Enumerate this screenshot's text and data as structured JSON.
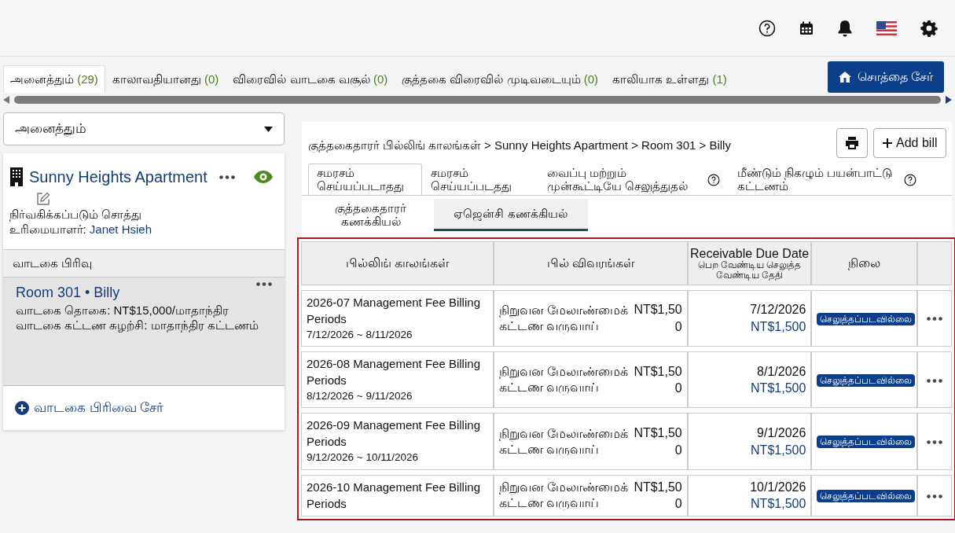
{
  "filter_tabs": [
    {
      "label": "அனைத்தும்",
      "count": "(29)",
      "selected": true
    },
    {
      "label": "காலாவதியானது",
      "count": "(0)",
      "selected": false
    },
    {
      "label": "விரைவில் வாடகை வசூல்",
      "count": "(0)",
      "selected": false
    },
    {
      "label": "குத்தகை விரைவில் முடிவடையும்",
      "count": "(0)",
      "selected": false
    },
    {
      "label": "காலியாக உள்ளது",
      "count": "(1)",
      "selected": false
    }
  ],
  "add_property_button": "சொத்தை சேர்",
  "property_select": {
    "value": "அனைத்தும்"
  },
  "property": {
    "name": "Sunny Heights Apartment",
    "visible": true,
    "type": "நிர்வகிக்கப்படும் சொத்து",
    "owner_label": "உரிமையாளர்:",
    "owner": "Janet Hsieh"
  },
  "section_header": "வாடகை பிரிவு",
  "units": [
    {
      "title": "Room 301 • Billy",
      "selected": true,
      "lines": [
        "வாடகை தொகை: NT$15,000/மாதாந்திர",
        "வாடகை கட்டண சுழற்சி: மாதாந்திர கட்டணம்"
      ]
    }
  ],
  "add_unit_link": "வாடகை பிரிவை சேர்",
  "breadcrumb": "குத்தகைதாரர் பில்லிங் காலங்கள் > Sunny Heights Apartment > Room 301 > Billy",
  "add_bill_button": "Add bill",
  "main_tabs": [
    {
      "label": "சமரசம் செய்யப்படாதது",
      "help": false,
      "selected": true
    },
    {
      "label": "சமரசம் செய்யப்படதது",
      "help": false,
      "selected": false
    },
    {
      "label": "வைப்பு மற்றும் முன்கூட்டியே செலுத்துதல்",
      "help": true,
      "selected": false
    },
    {
      "label": "மீண்டும் நிகழும் பயன்பாட்டு கட்டணம்",
      "help": true,
      "selected": false
    }
  ],
  "sub_tabs": [
    {
      "label": "குத்தகைதாரர் கணக்கியல்",
      "selected": false
    },
    {
      "label": "ஏஜென்சி கணக்கியல்",
      "selected": true
    }
  ],
  "table": {
    "columns": [
      "பில்லிங் காலங்கள்",
      "பில் விவரங்கள்",
      {
        "title": "Receivable Due Date",
        "subtitle": "பெற வேண்டிய செலுத்த வேண்டிய தேதி"
      },
      "நிலை"
    ],
    "rows": [
      {
        "title": "2026-07 Management Fee Billing Periods",
        "range": "7/12/2026 ~ 8/11/2026",
        "description": "நிறுவன மேலாண்மைக் கட்டண வருவாய்",
        "amount": "NT$1,500",
        "due_date": "7/12/2026",
        "due_amount": "NT$1,500",
        "status": "செலுத்தப்படவில்லை"
      },
      {
        "title": "2026-08 Management Fee Billing Periods",
        "range": "8/12/2026 ~ 9/11/2026",
        "description": "நிறுவன மேலாண்மைக் கட்டண வருவாய்",
        "amount": "NT$1,500",
        "due_date": "8/1/2026",
        "due_amount": "NT$1,500",
        "status": "செலுத்தப்படவில்லை"
      },
      {
        "title": "2026-09 Management Fee Billing Periods",
        "range": "9/12/2026 ~ 10/11/2026",
        "description": "நிறுவன மேலாண்மைக் கட்டண வருவாய்",
        "amount": "NT$1,500",
        "due_date": "9/1/2026",
        "due_amount": "NT$1,500",
        "status": "செலுத்தப்படவில்லை"
      },
      {
        "title": "2026-10 Management Fee Billing Periods",
        "description": "நிறுவன மேலாண்மைக் கட்டண வருவாய்",
        "amount": "NT$1,500",
        "due_date": "10/1/2026",
        "due_amount": "NT$1,500",
        "status": "செலுத்தப்படவில்லை"
      }
    ]
  }
}
